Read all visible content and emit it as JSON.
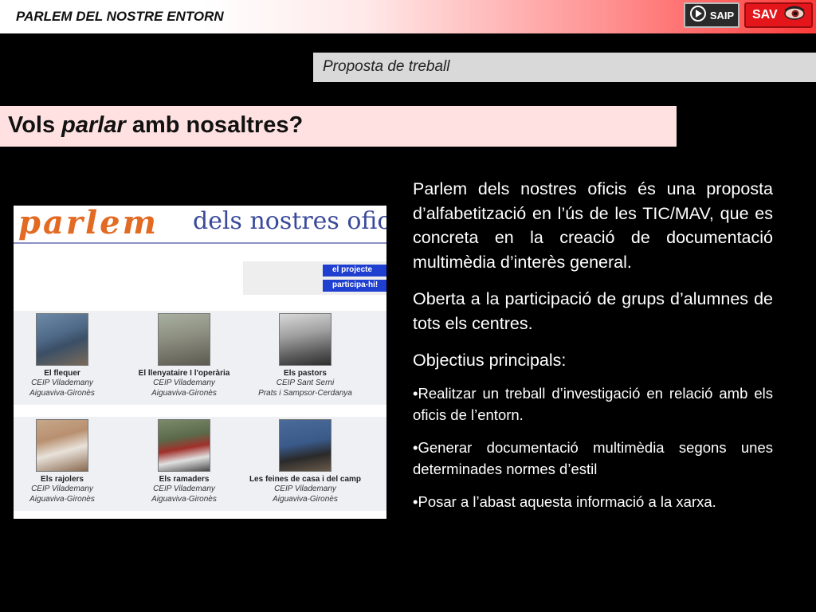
{
  "header": {
    "title": "PARLEM DEL NOSTRE ENTORN",
    "saip_label": "SAIP",
    "sav_label": "SAV"
  },
  "subtitle": "Proposta de treball",
  "heading": {
    "part1": "Vols ",
    "emph": "parlar",
    "part2": " amb nosaltres?"
  },
  "screenshot": {
    "logo_word": "parlem",
    "logo_rest": "dels nostres oficis",
    "menu": [
      "el projecte",
      "participa-hi!"
    ],
    "cards": [
      {
        "title": "El flequer",
        "school": "CEIP Vilademany",
        "place": "Aiguaviva-Gironès"
      },
      {
        "title": "El llenyataire I l'operària",
        "school": "CEIP Vilademany",
        "place": "Aiguaviva-Gironès"
      },
      {
        "title": "Els pastors",
        "school": "CEIP Sant Serni",
        "place": "Prats i Sampsor-Cerdanya"
      },
      {
        "title": "Els rajolers",
        "school": "CEIP Vilademany",
        "place": "Aiguaviva-Gironès"
      },
      {
        "title": "Els ramaders",
        "school": "CEIP Vilademany",
        "place": "Aiguaviva-Gironès"
      },
      {
        "title": "Les feines de casa i del camp",
        "school": "CEIP Vilademany",
        "place": "Aiguaviva-Gironès"
      }
    ]
  },
  "body": {
    "para1": "Parlem dels nostres oficis és una proposta d’alfabetització en l’ús de les TIC/MAV, que es concreta en la creació de documentació multimèdia d’interès general.",
    "para2": "Oberta a la participació de grups d’alumnes de tots els centres.",
    "para3": "Objectius principals:",
    "bullets": [
      "•Realitzar un treball d’investigació en relació amb els oficis de l’entorn.",
      "•Generar documentació multimèdia segons unes determinades normes d’estil",
      "•Posar a l’abast aquesta informació a la xarxa."
    ]
  },
  "colors": {
    "background": "#000000",
    "heading_bg": "#ffe1e1",
    "subtitle_bg": "#d9d9d9",
    "sav_red": "#e4151b",
    "menu_blue": "#1f3fd1",
    "logo_orange": "#e26a23"
  },
  "icons": {
    "saip": "play-circle-icon",
    "sav": "eye-icon"
  }
}
